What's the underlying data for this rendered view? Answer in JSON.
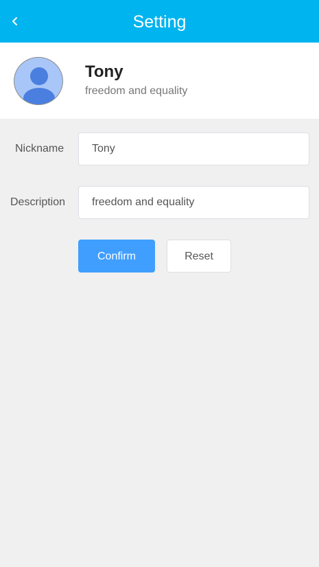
{
  "header": {
    "title": "Setting",
    "background_color": "#00b4ef",
    "back_icon": "chevron-left-icon"
  },
  "profile": {
    "name": "Tony",
    "description": "freedom and equality",
    "avatar_icon": "user-avatar-icon",
    "avatar_color": "#a8c6f7"
  },
  "form": {
    "nickname_label": "Nickname",
    "nickname_value": "Tony",
    "description_label": "Description",
    "description_value": "freedom and equality",
    "confirm_label": "Confirm",
    "reset_label": "Reset",
    "confirm_color": "#409eff"
  }
}
